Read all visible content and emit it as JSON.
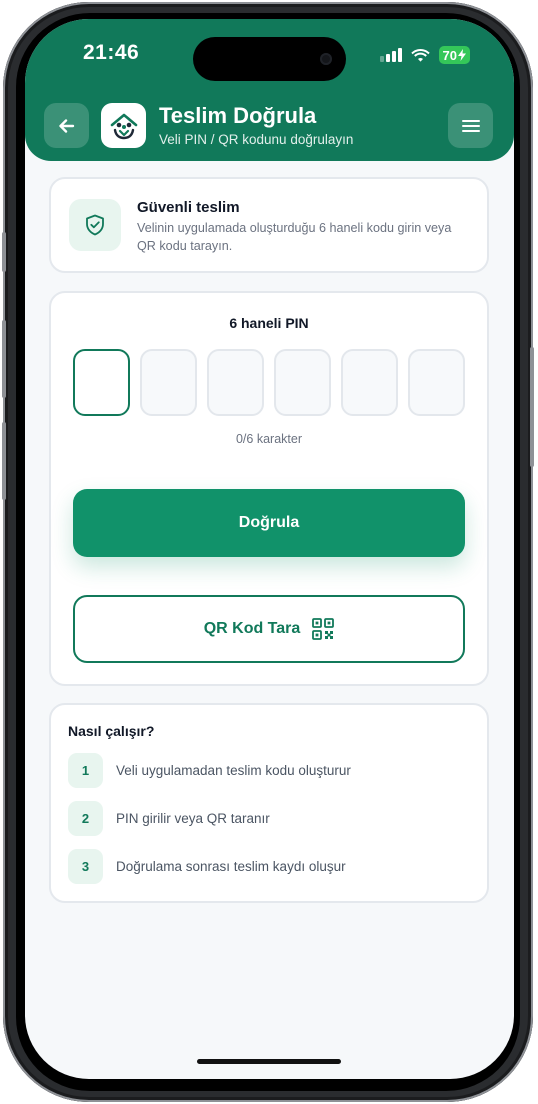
{
  "status_bar": {
    "time": "21:46",
    "battery": "70"
  },
  "header": {
    "title": "Teslim Doğrula",
    "subtitle": "Veli PIN / QR kodunu doğrulayın",
    "back_icon": "arrow-left-icon",
    "menu_icon": "hamburger-menu-icon",
    "logo_icon": "family-house-logo-icon"
  },
  "info": {
    "title": "Güvenli teslim",
    "body": "Velinin uygulamada oluşturduğu 6 haneli kodu girin veya QR kodu tarayın.",
    "icon": "shield-check-icon"
  },
  "pin": {
    "label": "6 haneli PIN",
    "digits": [
      "",
      "",
      "",
      "",
      "",
      ""
    ],
    "counter": "0/6 karakter",
    "verify_label": "Doğrula",
    "qr_label": "QR Kod Tara",
    "qr_icon": "qr-code-icon"
  },
  "how": {
    "title": "Nasıl çalışır?",
    "steps": [
      {
        "num": "1",
        "text": "Veli uygulamadan teslim kodu oluşturur"
      },
      {
        "num": "2",
        "text": "PIN girilir veya QR taranır"
      },
      {
        "num": "3",
        "text": "Doğrulama sonrası teslim kaydı oluşur"
      }
    ]
  },
  "colors": {
    "brand": "#11795a",
    "button": "#11926a",
    "accent_bg": "#e8f5ef",
    "screen_bg": "#f6f8fa"
  }
}
